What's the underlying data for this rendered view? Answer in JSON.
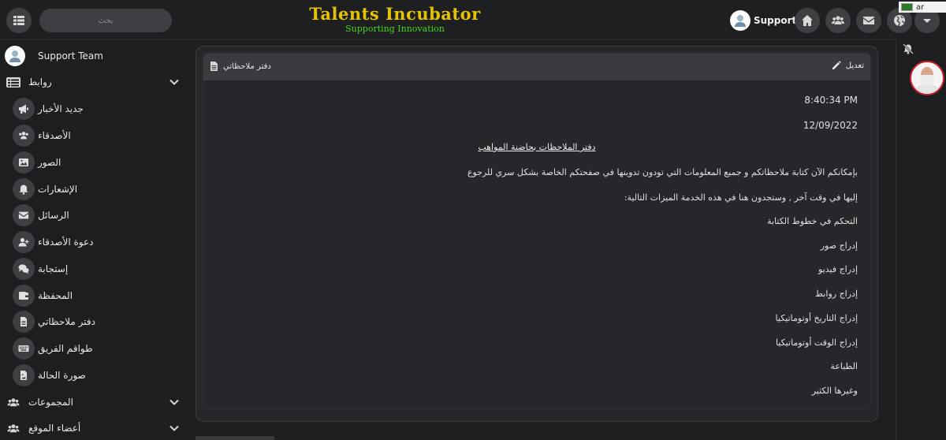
{
  "header": {
    "search_placeholder": "بحث",
    "brand_title": "Talents Incubator",
    "brand_subtitle": "Supporting Innovation",
    "support_label": "Support",
    "language": "ar",
    "nav_icons": [
      "home-icon",
      "users-icon",
      "envelope-icon",
      "globe-icon",
      "caret-down-icon"
    ]
  },
  "sidebar": {
    "profile_name": "Support Team",
    "sections": [
      {
        "label": "روابط",
        "icon": "list-icon"
      },
      {
        "label": "المجموعات",
        "icon": "users-icon"
      },
      {
        "label": "أعضاء الموقع",
        "icon": "users-icon"
      }
    ],
    "items": [
      {
        "label": "جديد الأخبار",
        "icon": "megaphone-icon"
      },
      {
        "label": "الأصدقاء",
        "icon": "friends-icon"
      },
      {
        "label": "الصور",
        "icon": "image-icon"
      },
      {
        "label": "الإشعارات",
        "icon": "bell-icon"
      },
      {
        "label": "الرسائل",
        "icon": "envelope-icon"
      },
      {
        "label": "دعوة الأصدقاء",
        "icon": "user-plus-icon"
      },
      {
        "label": "إستجابة",
        "icon": "comments-icon"
      },
      {
        "label": "المحفظة",
        "icon": "wallet-icon"
      },
      {
        "label": "دفتر ملاحظاتي",
        "icon": "document-icon"
      },
      {
        "label": "طواقم الفريق",
        "icon": "keyboard-icon"
      },
      {
        "label": "صورة الحالة",
        "icon": "status-image-icon"
      }
    ]
  },
  "card": {
    "title": "دفتر ملاحظاتي",
    "edit_label": "تعديل",
    "time": "8:40:34 PM",
    "date": "12/09/2022",
    "note_title": "دفتر الملاحظات بحاضنة المواهب",
    "paragraph1": "بإمكانكم الآن كتابة ملاحظاتكم و جميع المعلومات التي تودون تدوينها في صفحتكم الخاصة بشكل سري للرجوع",
    "paragraph2": "إليها في وقت آخر , وستجدون هنا في هذه الخدمة الميزات التالية:",
    "features": [
      "التحكم في خطوط الكتابة",
      "إدراج صور",
      "إدراج فيديو",
      "إدراج روابط",
      "إدراج التاريخ أوتوماتيكيا",
      "إدراج الوقت أوتوماتيكيا",
      "الطباعة",
      "وغيرها الكثير"
    ]
  },
  "colors": {
    "brand_title": "#e6c200",
    "brand_subtitle": "#4ad21a",
    "background": "#1d1e20",
    "card": "#26272a",
    "avatar_border": "#c8202a"
  }
}
